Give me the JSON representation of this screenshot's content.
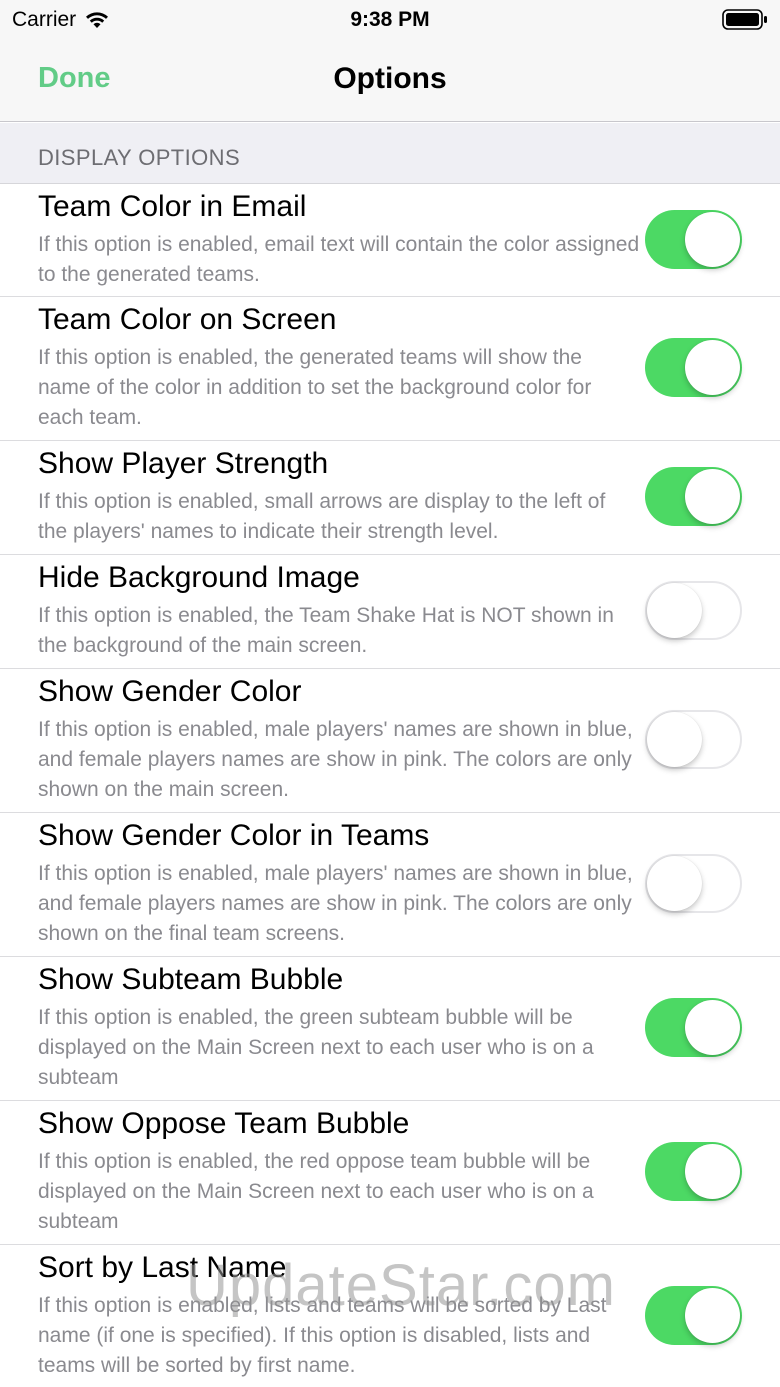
{
  "status_bar": {
    "carrier": "Carrier",
    "time": "9:38 PM"
  },
  "nav": {
    "done_label": "Done",
    "title": "Options"
  },
  "section": {
    "label": "DISPLAY OPTIONS"
  },
  "colors": {
    "accent_green": "#62cc87",
    "toggle_on": "#4cd964"
  },
  "options": [
    {
      "title": "Team Color in Email",
      "description": "If this option is enabled, email text will contain the color assigned to the generated teams.",
      "enabled": true
    },
    {
      "title": "Team Color on Screen",
      "description": "If this option is enabled, the generated teams will show the name of the color in addition to set the background color for each team.",
      "enabled": true
    },
    {
      "title": "Show Player Strength",
      "description": "If this option is enabled, small arrows are display to the left of the players' names to indicate their strength level.",
      "enabled": true
    },
    {
      "title": "Hide Background Image",
      "description": "If this option is enabled, the Team Shake Hat is NOT shown in the background of the main screen.",
      "enabled": false
    },
    {
      "title": "Show Gender Color",
      "description": "If this option is enabled, male players' names are shown in blue, and female players names are show in pink.  The colors are only shown on the main screen.",
      "enabled": false
    },
    {
      "title": "Show Gender Color in Teams",
      "description": "If this option is enabled, male players' names are shown in blue, and female players names are show in pink.  The colors are only shown on the final team screens.",
      "enabled": false
    },
    {
      "title": "Show Subteam Bubble",
      "description": "If this option is enabled, the green subteam bubble will be displayed on the Main Screen next to each user who is on a subteam",
      "enabled": true
    },
    {
      "title": "Show Oppose Team Bubble",
      "description": "If this option is enabled, the red oppose team bubble will be displayed on the Main Screen next to each user who is on a subteam",
      "enabled": true
    },
    {
      "title": "Sort by Last Name",
      "description": "If this option is enabled, lists and teams will be sorted by Last name (if one is specified).  If this option is disabled, lists and teams will be sorted by first name.",
      "enabled": true
    }
  ],
  "watermark": "UpdateStar.com"
}
